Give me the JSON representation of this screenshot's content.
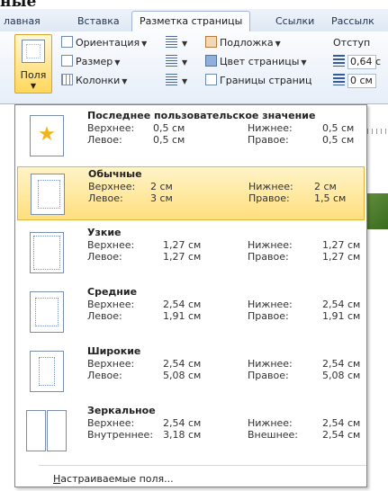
{
  "background_text": "ные",
  "tabs": [
    {
      "label": "лавная",
      "active": false
    },
    {
      "label": "Вставка",
      "active": false
    },
    {
      "label": "Разметка страницы",
      "active": true
    },
    {
      "label": "Ссылки",
      "active": false
    },
    {
      "label": "Рассылк",
      "active": false
    }
  ],
  "ribbon": {
    "fields_button": "Поля",
    "orientation": "Ориентация",
    "size": "Размер",
    "columns": "Колонки",
    "watermark": "Подложка",
    "page_color": "Цвет страницы",
    "page_borders": "Границы страниц",
    "indent_label": "Отступ",
    "indent_left": "0,64 с",
    "indent_right": "0 см"
  },
  "margin_presets": [
    {
      "name": "Последнее пользовательское значение",
      "label1": "Верхнее:",
      "val1": "0,5 см",
      "label2": "Нижнее:",
      "val2": "0,5 см",
      "label3": "Левое:",
      "val3": "0,5 см",
      "label4": "Правое:",
      "val4": "0,5 см",
      "icon": "star",
      "selected": false
    },
    {
      "name": "Обычные",
      "label1": "Верхнее:",
      "val1": "2 см",
      "label2": "Нижнее:",
      "val2": "2 см",
      "label3": "Левое:",
      "val3": "3 см",
      "label4": "Правое:",
      "val4": "1,5 см",
      "icon": "normal",
      "selected": true
    },
    {
      "name": "Узкие",
      "label1": "Верхнее:",
      "val1": "1,27 см",
      "label2": "Нижнее:",
      "val2": "1,27 см",
      "label3": "Левое:",
      "val3": "1,27 см",
      "label4": "Правое:",
      "val4": "1,27 см",
      "icon": "narrow",
      "selected": false
    },
    {
      "name": "Средние",
      "label1": "Верхнее:",
      "val1": "2,54 см",
      "label2": "Нижнее:",
      "val2": "2,54 см",
      "label3": "Левое:",
      "val3": "1,91 см",
      "label4": "Правое:",
      "val4": "1,91 см",
      "icon": "moderate",
      "selected": false
    },
    {
      "name": "Широкие",
      "label1": "Верхнее:",
      "val1": "2,54 см",
      "label2": "Нижнее:",
      "val2": "2,54 см",
      "label3": "Левое:",
      "val3": "5,08 см",
      "label4": "Правое:",
      "val4": "5,08 см",
      "icon": "wide",
      "selected": false
    },
    {
      "name": "Зеркальное",
      "label1": "Верхнее:",
      "val1": "2,54 см",
      "label2": "Нижнее:",
      "val2": "2,54 см",
      "label3": "Внутреннее:",
      "val3": "3,18 см",
      "label4": "Внешнее:",
      "val4": "2,54 см",
      "icon": "mirrored",
      "selected": false
    }
  ],
  "custom_margins": {
    "accel": "Н",
    "rest": "астраиваемые поля..."
  }
}
